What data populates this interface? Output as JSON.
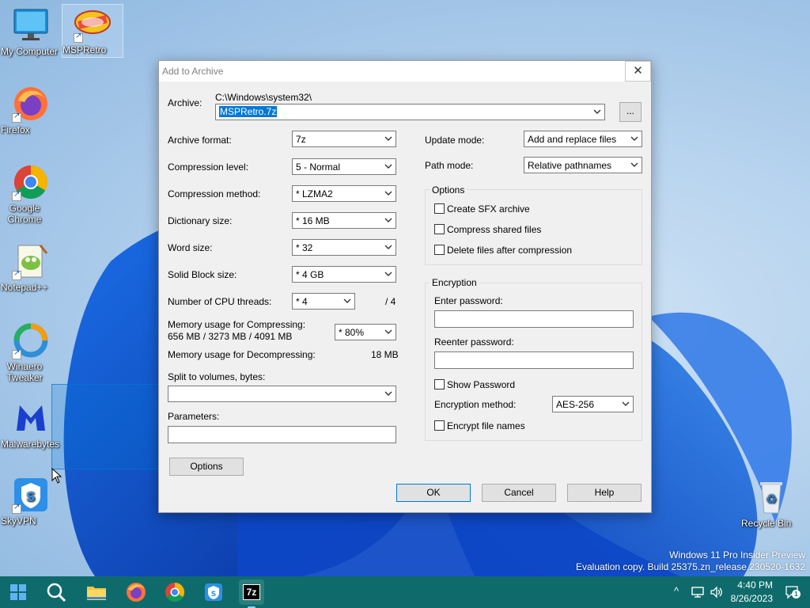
{
  "desktop": {
    "icons": [
      {
        "label": "My Computer",
        "icon": "monitor-icon"
      },
      {
        "label": "MSPRetro",
        "icon": "msp-logo-icon"
      },
      {
        "label": "Firefox",
        "icon": "firefox-icon"
      },
      {
        "label": "Google Chrome",
        "icon": "chrome-icon"
      },
      {
        "label": "Notepad++",
        "icon": "notepadpp-icon"
      },
      {
        "label": "Winaero Tweaker",
        "icon": "winaero-icon"
      },
      {
        "label": "Malwarebytes",
        "icon": "malwarebytes-icon"
      },
      {
        "label": "SkyVPN",
        "icon": "skyvpn-icon"
      },
      {
        "label": "Recycle Bin",
        "icon": "recycle-bin-icon"
      }
    ],
    "watermark_line1": "Windows 11 Pro Insider Preview",
    "watermark_line2": "Evaluation copy. Build 25375.zn_release.230520-1632"
  },
  "dialog": {
    "title": "Add to Archive",
    "close_label": "✕",
    "archive_label": "Archive:",
    "archive_path": "C:\\Windows\\system32\\",
    "archive_value": "MSPRetro.7z",
    "browse_label": "...",
    "left": {
      "archive_format_label": "Archive format:",
      "archive_format_value": "7z",
      "compression_level_label": "Compression level:",
      "compression_level_value": "5 - Normal",
      "compression_method_label": "Compression method:",
      "compression_method_value": "*  LZMA2",
      "dictionary_size_label": "Dictionary size:",
      "dictionary_size_value": "*  16 MB",
      "word_size_label": "Word size:",
      "word_size_value": "*  32",
      "solid_block_label": "Solid Block size:",
      "solid_block_value": "*  4 GB",
      "cpu_threads_label": "Number of CPU threads:",
      "cpu_threads_value": "*  4",
      "cpu_threads_max": "/ 4",
      "mem_compress_label": "Memory usage for Compressing:",
      "mem_compress_detail": "656 MB / 3273 MB / 4091 MB",
      "mem_compress_value": "* 80%",
      "mem_decompress_label": "Memory usage for Decompressing:",
      "mem_decompress_value": "18 MB",
      "split_label": "Split to volumes, bytes:",
      "split_value": "",
      "parameters_label": "Parameters:",
      "parameters_value": "",
      "options_button": "Options"
    },
    "right": {
      "update_mode_label": "Update mode:",
      "update_mode_value": "Add and replace files",
      "path_mode_label": "Path mode:",
      "path_mode_value": "Relative pathnames",
      "options_group": "Options",
      "create_sfx": "Create SFX archive",
      "compress_shared": "Compress shared files",
      "delete_after": "Delete files after compression",
      "encryption_group": "Encryption",
      "enter_password_label": "Enter password:",
      "reenter_password_label": "Reenter password:",
      "show_password": "Show Password",
      "encryption_method_label": "Encryption method:",
      "encryption_method_value": "AES-256",
      "encrypt_names": "Encrypt file names"
    },
    "buttons": {
      "ok": "OK",
      "cancel": "Cancel",
      "help": "Help"
    }
  },
  "taskbar": {
    "apps": [
      "start-icon",
      "search-icon",
      "file-explorer-icon",
      "firefox-icon",
      "chrome-icon",
      "skyvpn-icon",
      "7zip-icon"
    ],
    "seven_zip_label": "7z",
    "time": "4:40 PM",
    "date": "8/26/2023",
    "notification_count": "1",
    "chevron": "^"
  }
}
